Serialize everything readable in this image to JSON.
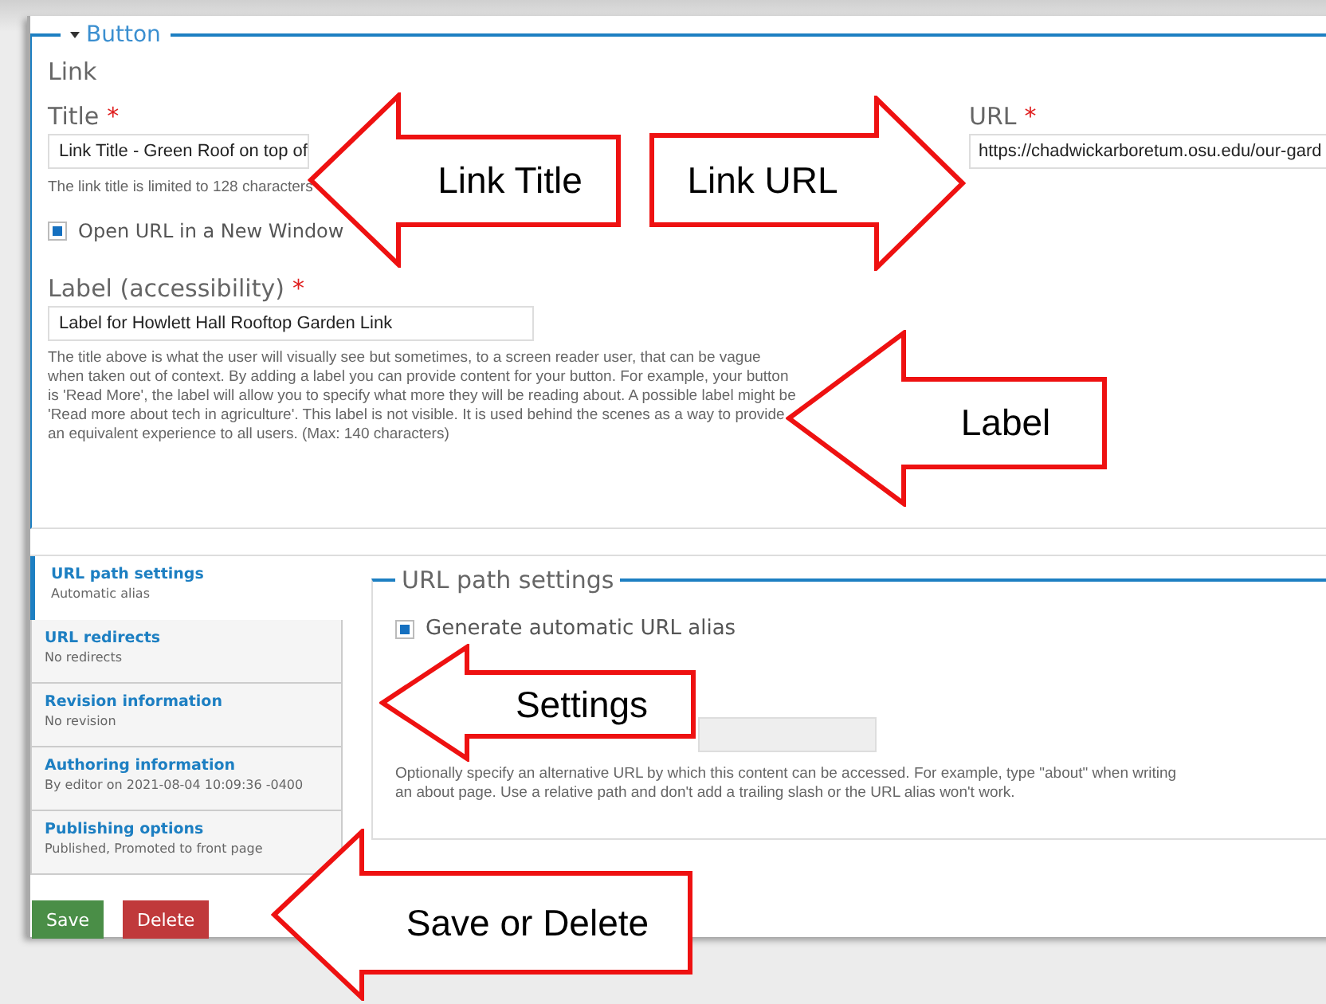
{
  "fieldset": {
    "title": "Button",
    "expanded": true
  },
  "link_section": {
    "heading": "Link"
  },
  "title_field": {
    "label": "Title",
    "required_mark": "*",
    "value": "Link Title - Green Roof on top of",
    "description": "The link title is limited to 128 characters"
  },
  "url_field": {
    "label": "URL",
    "required_mark": "*",
    "value": "https://chadwickarboretum.osu.edu/our-gard"
  },
  "new_window": {
    "label": "Open URL in a New Window",
    "checked": true
  },
  "label_field": {
    "label": "Label (accessibility)",
    "required_mark": "*",
    "value": "Label for Howlett Hall Rooftop Garden Link",
    "description": "The title above is what the user will visually see but sometimes, to a screen reader user, that can be vague when taken out of context. By adding a label you can provide content for your button. For example, your button is 'Read More', the label will allow you to specify what more they will be reading about. A possible label might be 'Read more about tech in agriculture'. This label is not visible. It is used behind the scenes as a way to provide an equivalent experience to all users. (Max: 140 characters)"
  },
  "vertical_tabs": [
    {
      "title": "URL path settings",
      "summary": "Automatic alias",
      "selected": true
    },
    {
      "title": "URL redirects",
      "summary": "No redirects",
      "selected": false
    },
    {
      "title": "Revision information",
      "summary": "No revision",
      "selected": false
    },
    {
      "title": "Authoring information",
      "summary": "By editor on 2021-08-04 10:09:36 -0400",
      "selected": false
    },
    {
      "title": "Publishing options",
      "summary": "Published, Promoted to front page",
      "selected": false
    }
  ],
  "url_path_settings": {
    "title": "URL path settings",
    "generate_alias": {
      "label": "Generate automatic URL alias",
      "checked": true
    },
    "description": "Optionally specify an alternative URL by which this content can be accessed. For example, type \"about\" when writing an about page. Use a relative path and don't add a trailing slash or the URL alias won't work."
  },
  "actions": [
    {
      "label": "Save",
      "kind": "primary"
    },
    {
      "label": "Delete",
      "kind": "danger"
    }
  ],
  "callouts": [
    {
      "text": "Link Title",
      "kind": "left"
    },
    {
      "text": "Link URL",
      "kind": "right"
    },
    {
      "text": "Label",
      "kind": "left"
    },
    {
      "text": "Settings",
      "kind": "left"
    },
    {
      "text": "Save or Delete",
      "kind": "left"
    }
  ]
}
